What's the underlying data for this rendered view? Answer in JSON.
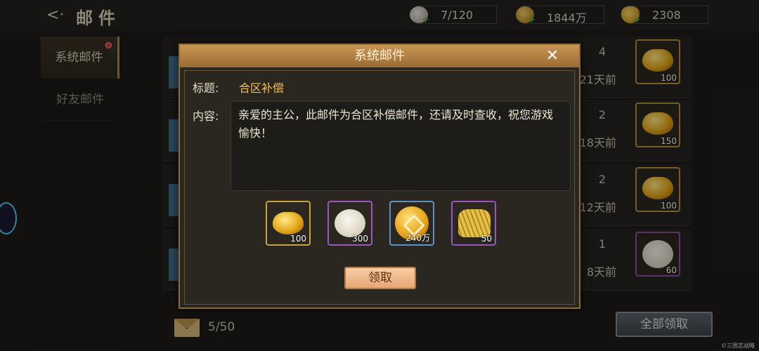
{
  "header": {
    "title": "邮件",
    "back_icon": "back-arrow-icon"
  },
  "resources": [
    {
      "icon": "silver-icon",
      "value": "7/120"
    },
    {
      "icon": "copper-coin-icon",
      "value": "1844万"
    },
    {
      "icon": "gold-ingot-icon",
      "value": "2308"
    }
  ],
  "tabs": [
    {
      "label": "系统邮件",
      "active": true,
      "has_dot": true
    },
    {
      "label": "好友邮件",
      "active": false
    }
  ],
  "mail_list": [
    {
      "count": "4",
      "age": "21天前",
      "item_icon": "gold-ingot-icon",
      "item_qty": "100",
      "item_color": "gold"
    },
    {
      "count": "2",
      "age": "18天前",
      "item_icon": "gold-ingot-icon",
      "item_qty": "150",
      "item_color": "gold"
    },
    {
      "count": "2",
      "age": "12天前",
      "item_icon": "gold-ingot-icon",
      "item_qty": "100",
      "item_color": "gold"
    },
    {
      "count": "1",
      "age": "8天前",
      "item_icon": "steamed-bun-icon",
      "item_qty": "60",
      "item_color": "purple"
    }
  ],
  "footer": {
    "mail_count": "5/50",
    "claim_all_label": "全部领取"
  },
  "modal": {
    "title": "系统邮件",
    "subject_label": "标题:",
    "subject": "合区补偿",
    "content_label": "内容:",
    "content": "亲爱的主公，此邮件为合区补偿邮件，还请及时查收，祝您游戏愉快！",
    "rewards": [
      {
        "icon": "gold-ingot-icon",
        "qty": "100"
      },
      {
        "icon": "steamed-bun-icon",
        "qty": "300"
      },
      {
        "icon": "gold-coin-icon",
        "qty": "240万"
      },
      {
        "icon": "grain-bundle-icon",
        "qty": "50"
      }
    ],
    "claim_label": "领取"
  },
  "watermark": "©三国志战略"
}
